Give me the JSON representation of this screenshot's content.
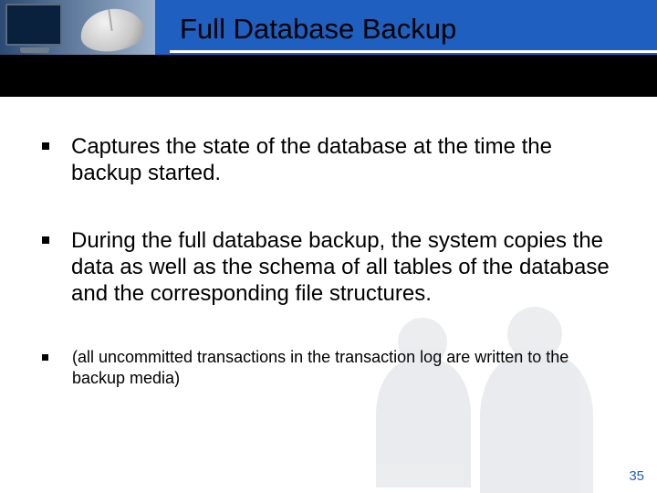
{
  "header": {
    "title": "Full Database Backup"
  },
  "bullets": [
    {
      "text": "Captures the state of the database at the time the backup started."
    },
    {
      "text": "During the full database backup, the system copies the data as well as the schema of all tables of the database and the corresponding file structures."
    },
    {
      "text": "(all uncommitted transactions in the transaction log are written to the backup media)"
    }
  ],
  "page_number": "35"
}
